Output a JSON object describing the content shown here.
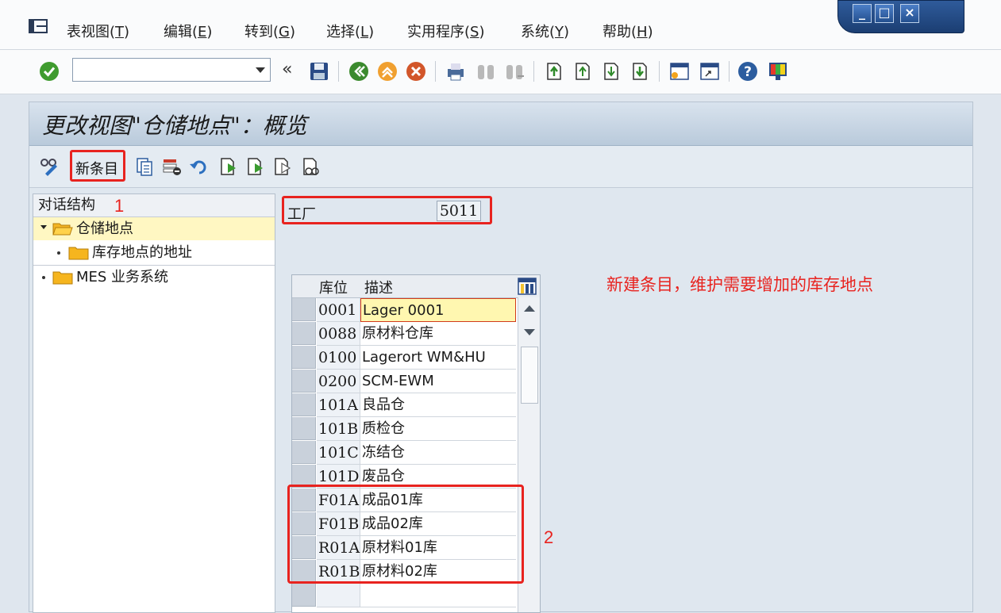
{
  "menu": {
    "items": [
      {
        "label": "表视图(",
        "key": "T",
        "end": ")"
      },
      {
        "label": "编辑(",
        "key": "E",
        "end": ")"
      },
      {
        "label": "转到(",
        "key": "G",
        "end": ")"
      },
      {
        "label": "选择(",
        "key": "L",
        "end": ")"
      },
      {
        "label": "实用程序(",
        "key": "S",
        "end": ")"
      },
      {
        "label": "系统(",
        "key": "Y",
        "end": ")"
      },
      {
        "label": "帮助(",
        "key": "H",
        "end": ")"
      }
    ]
  },
  "command_field": {
    "value": ""
  },
  "screen": {
    "title": "更改视图\"仓储地点\"：概览"
  },
  "app_toolbar": {
    "new_entries_label": "新条目"
  },
  "tree": {
    "header": "对话结构",
    "items": [
      {
        "label": "仓储地点",
        "selected": true
      },
      {
        "label": "库存地点的地址",
        "selected": false
      },
      {
        "label": "MES 业务系统",
        "selected": false
      }
    ]
  },
  "plant": {
    "label": "工厂",
    "value": "5011"
  },
  "table": {
    "headers": {
      "code": "库位",
      "desc": "描述"
    },
    "rows": [
      {
        "code": "0001",
        "desc": "Lager 0001"
      },
      {
        "code": "0088",
        "desc": "原材料仓库"
      },
      {
        "code": "0100",
        "desc": "Lagerort WM&HU"
      },
      {
        "code": "0200",
        "desc": "SCM-EWM"
      },
      {
        "code": "101A",
        "desc": "良品仓"
      },
      {
        "code": "101B",
        "desc": "质检仓"
      },
      {
        "code": "101C",
        "desc": "冻结仓"
      },
      {
        "code": "101D",
        "desc": "废品仓"
      },
      {
        "code": "F01A",
        "desc": "成品01库"
      },
      {
        "code": "F01B",
        "desc": "成品02库"
      },
      {
        "code": "R01A",
        "desc": "原材料01库"
      },
      {
        "code": "R01B",
        "desc": "原材料02库"
      },
      {
        "code": "",
        "desc": ""
      }
    ]
  },
  "annotations": {
    "marker1": "1",
    "marker2": "2",
    "note": "新建条目，维护需要增加的库存地点"
  },
  "colors": {
    "accent_red": "#e8231f",
    "selection_yellow": "#fff7c2"
  }
}
